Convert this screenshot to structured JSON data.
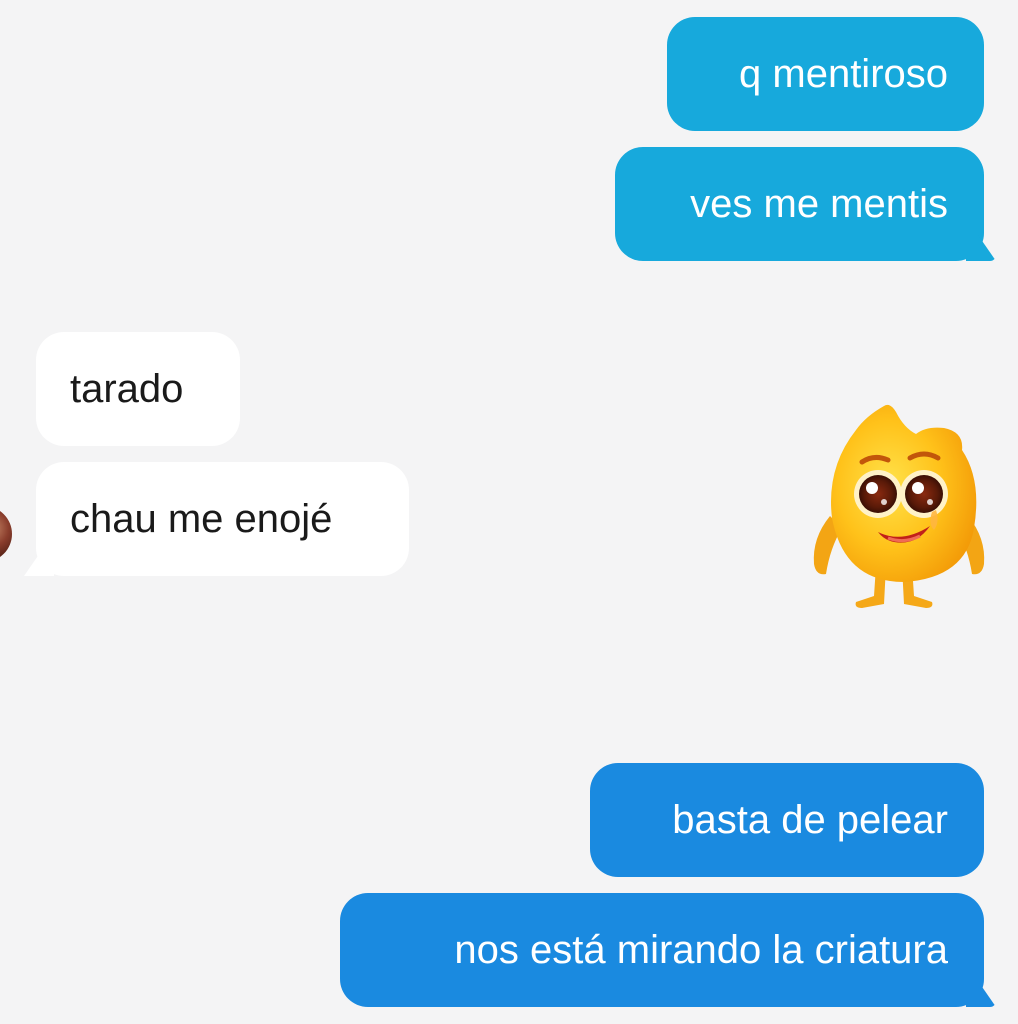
{
  "colors": {
    "background": "#f4f4f5",
    "outgoing_cyan": "#17a9dc",
    "outgoing_blue": "#1a8ae0",
    "incoming": "#ffffff"
  },
  "messages": [
    {
      "direction": "outgoing",
      "text": "q mentiroso"
    },
    {
      "direction": "outgoing",
      "text": "ves me mentis"
    },
    {
      "direction": "incoming",
      "text": "tarado"
    },
    {
      "direction": "incoming",
      "text": "chau me enojé"
    },
    {
      "direction": "outgoing",
      "text": "basta de pelear"
    },
    {
      "direction": "outgoing",
      "text": "nos está mirando la criatura"
    }
  ],
  "sticker": {
    "icon": "yellow-flame-creature-sticker"
  },
  "avatar": {
    "icon": "contact-avatar"
  }
}
